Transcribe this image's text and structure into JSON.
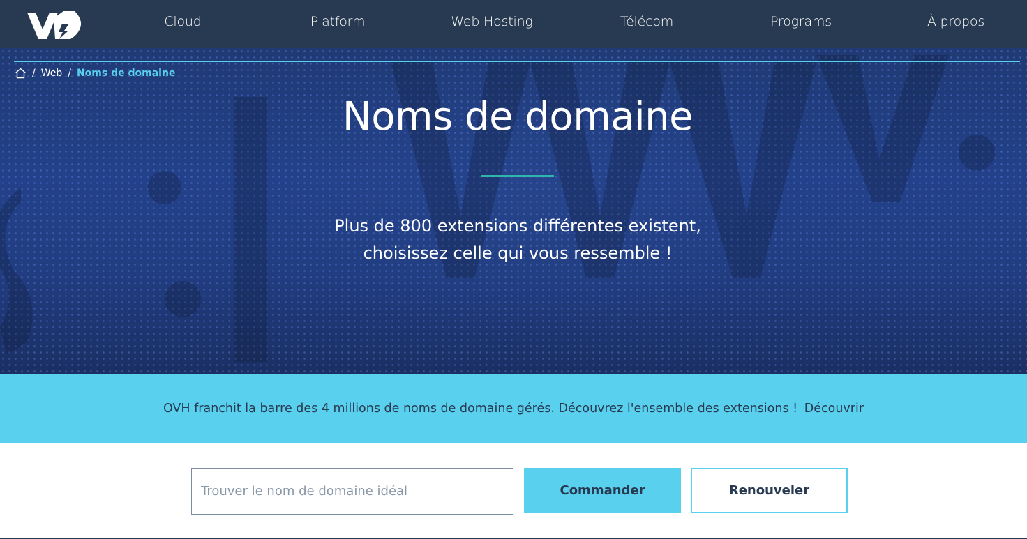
{
  "nav": {
    "logo": "ovh-logo",
    "items": [
      {
        "label": "Cloud"
      },
      {
        "label": "Platform"
      },
      {
        "label": "Web Hosting"
      },
      {
        "label": "Télécom"
      },
      {
        "label": "Programs"
      },
      {
        "label": "À propos"
      }
    ]
  },
  "breadcrumb": {
    "home_icon": "home-icon",
    "separator": "/",
    "items": [
      "Web",
      "Noms de domaine"
    ]
  },
  "hero": {
    "title": "Noms de domaine",
    "subtitle_line1": "Plus de 800 extensions différentes existent,",
    "subtitle_line2": "choisissez celle qui vous ressemble !"
  },
  "banner": {
    "text": "OVH franchit la barre des 4 millions de noms de domaine gérés. Découvrez l'ensemble des extensions !",
    "link": "Découvrir"
  },
  "search": {
    "placeholder": "Trouver le nom de domaine idéal",
    "value": "",
    "order_label": "Commander",
    "renew_label": "Renouveler"
  },
  "colors": {
    "nav_bg": "#283a51",
    "accent": "#59d0ee",
    "rule": "#2fb5ac",
    "text_dark": "#283a51"
  }
}
